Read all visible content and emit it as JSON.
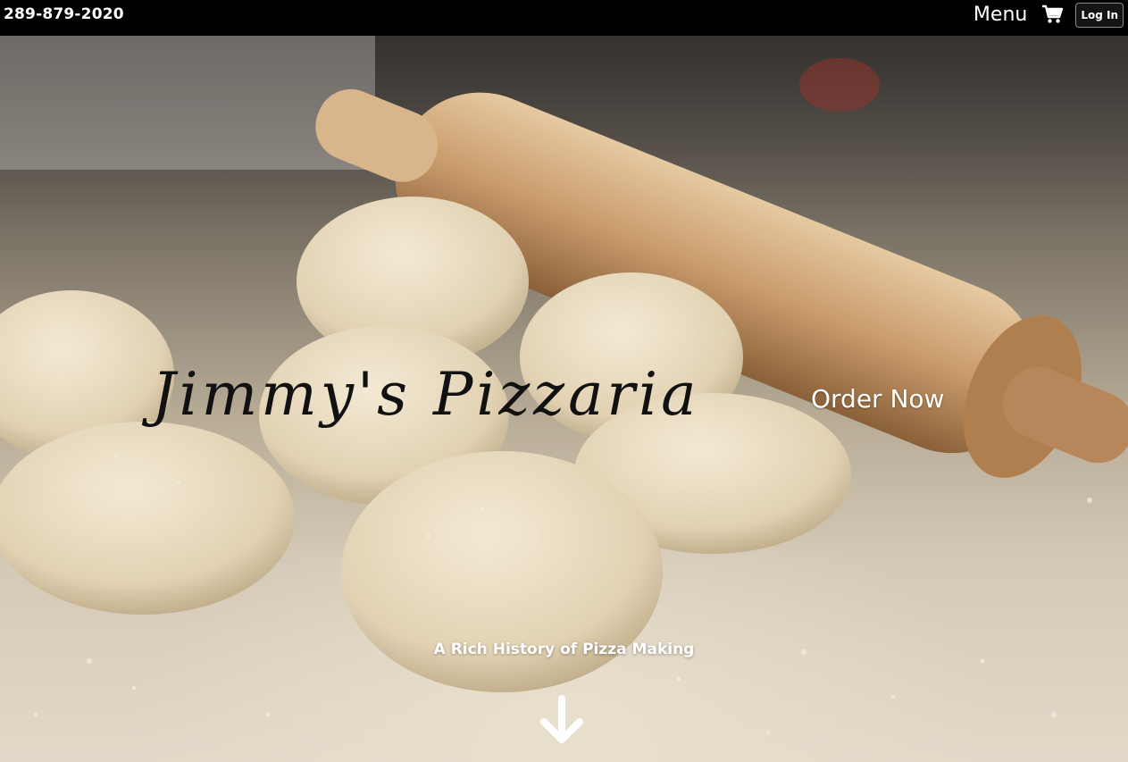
{
  "header": {
    "phone": "289-879-2020",
    "menu_label": "Menu",
    "cart_icon": "shopping-cart-icon",
    "login_label": "Log In"
  },
  "hero": {
    "brand_title": "Jimmy's Pizzaria",
    "order_label": "Order Now",
    "history_label": "A Rich History of Pizza Making",
    "scroll_icon": "arrow-down-icon"
  },
  "colors": {
    "topbar_bg": "#000000",
    "text_light": "#ffffff",
    "brand_text": "#111111"
  }
}
